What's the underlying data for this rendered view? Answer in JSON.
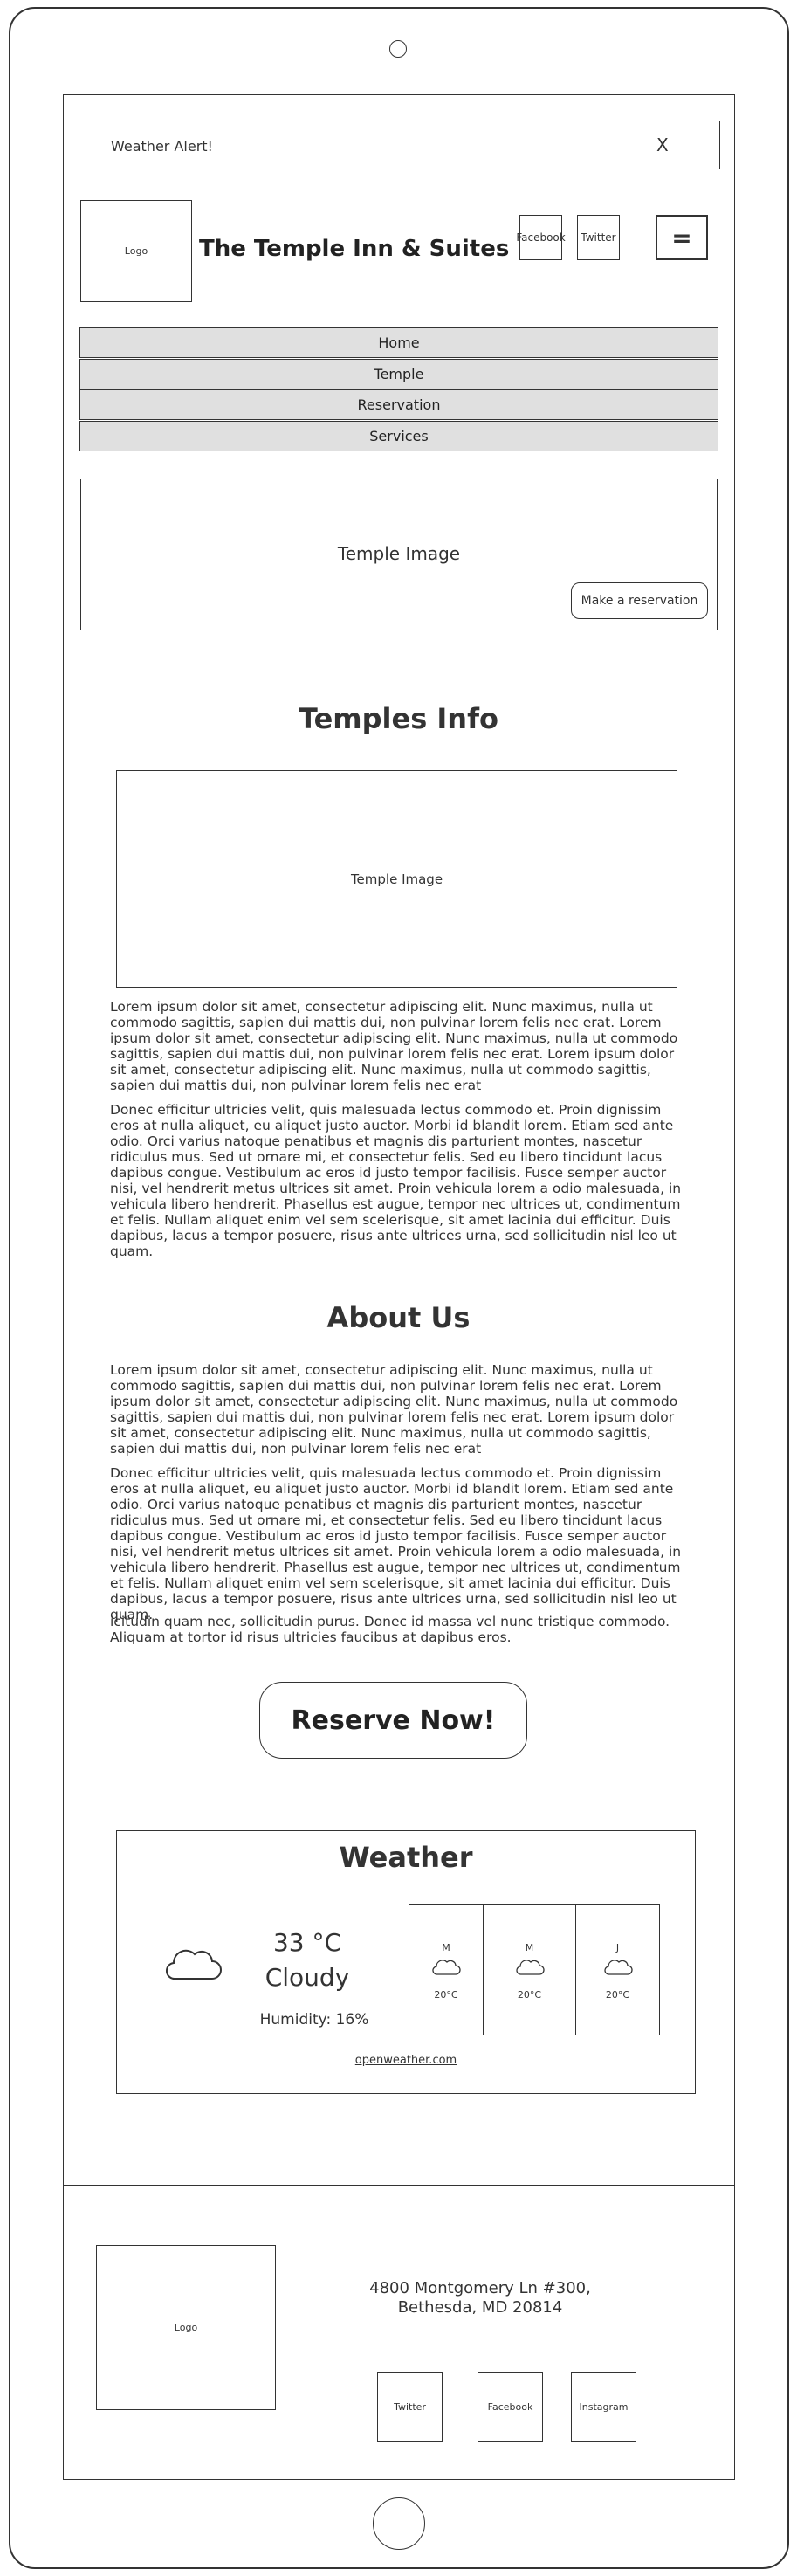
{
  "alert": {
    "text": "Weather Alert!",
    "close": "X"
  },
  "header": {
    "logo": "Logo",
    "title": "The Temple Inn & Suites",
    "social": [
      "Facebook",
      "Twitter"
    ],
    "menu_icon": "="
  },
  "nav": [
    "Home",
    "Temple",
    "Reservation",
    "Services"
  ],
  "hero": {
    "image_label": "Temple Image",
    "button": "Make a reservation"
  },
  "temples": {
    "heading": "Temples Info",
    "image_label": "Temple Image",
    "p1": "Lorem ipsum dolor sit amet, consectetur adipiscing elit. Nunc maximus, nulla ut commodo sagittis, sapien dui mattis dui, non pulvinar lorem felis nec erat. Lorem ipsum dolor sit amet, consectetur adipiscing elit. Nunc maximus, nulla ut commodo sagittis, sapien dui mattis dui, non pulvinar lorem felis nec erat. Lorem ipsum dolor sit amet, consectetur adipiscing elit. Nunc maximus, nulla ut commodo sagittis, sapien dui mattis dui, non pulvinar lorem felis nec erat",
    "p2": "Donec efficitur ultricies velit, quis malesuada lectus commodo et. Proin dignissim eros at nulla aliquet, eu aliquet justo auctor. Morbi id blandit lorem. Etiam sed ante odio. Orci varius natoque penatibus et magnis dis parturient montes, nascetur ridiculus mus. Sed ut ornare mi, et consectetur felis. Sed eu libero tincidunt lacus dapibus congue. Vestibulum ac eros id justo tempor facilisis. Fusce semper auctor nisi, vel hendrerit metus ultrices sit amet. Proin vehicula lorem a odio malesuada, in vehicula libero hendrerit. Phasellus est augue, tempor nec ultrices ut, condimentum et felis. Nullam aliquet enim vel sem scelerisque, sit amet lacinia dui efficitur. Duis dapibus, lacus a tempor posuere, risus ante ultrices urna, sed sollicitudin nisl leo ut quam."
  },
  "about": {
    "heading": "About Us",
    "p1": "Lorem ipsum dolor sit amet, consectetur adipiscing elit. Nunc maximus, nulla ut commodo sagittis, sapien dui mattis dui, non pulvinar lorem felis nec erat. Lorem ipsum dolor sit amet, consectetur adipiscing elit. Nunc maximus, nulla ut commodo sagittis, sapien dui mattis dui, non pulvinar lorem felis nec erat. Lorem ipsum dolor sit amet, consectetur adipiscing elit. Nunc maximus, nulla ut commodo sagittis, sapien dui mattis dui, non pulvinar lorem felis nec erat",
    "p2": "Donec efficitur ultricies velit, quis malesuada lectus commodo et. Proin dignissim eros at nulla aliquet, eu aliquet justo auctor. Morbi id blandit lorem. Etiam sed ante odio. Orci varius natoque penatibus et magnis dis parturient montes, nascetur ridiculus mus. Sed ut ornare mi, et consectetur felis. Sed eu libero tincidunt lacus dapibus congue. Vestibulum ac eros id justo tempor facilisis. Fusce semper auctor nisi, vel hendrerit metus ultrices sit amet. Proin vehicula lorem a odio malesuada, in vehicula libero hendrerit. Phasellus est augue, tempor nec ultrices ut, condimentum et felis. Nullam aliquet enim vel sem scelerisque, sit amet lacinia dui efficitur. Duis dapibus, lacus a tempor posuere, risus ante ultrices urna, sed sollicitudin nisl leo ut quam.",
    "p3": "icitudin quam nec, sollicitudin purus. Donec id massa vel nunc tristique commodo. Aliquam at tortor id risus ultricies faucibus at dapibus eros.",
    "button": "Reserve Now!"
  },
  "weather": {
    "heading": "Weather",
    "icon": "cloud-icon",
    "temp": "33 °C",
    "condition": "Cloudy",
    "humidity": "Humidity: 16%",
    "forecast": [
      {
        "day": "M",
        "temp": "20°C",
        "icon": "cloud-icon"
      },
      {
        "day": "M",
        "temp": "20°C",
        "icon": "cloud-icon"
      },
      {
        "day": "J",
        "temp": "20°C",
        "icon": "cloud-icon"
      }
    ],
    "link": "openweather.com"
  },
  "footer": {
    "logo": "Logo",
    "address_line1": "4800 Montgomery Ln #300,",
    "address_line2": "Bethesda, MD 20814",
    "social": [
      "Twitter",
      "Facebook",
      "Instagram"
    ]
  }
}
